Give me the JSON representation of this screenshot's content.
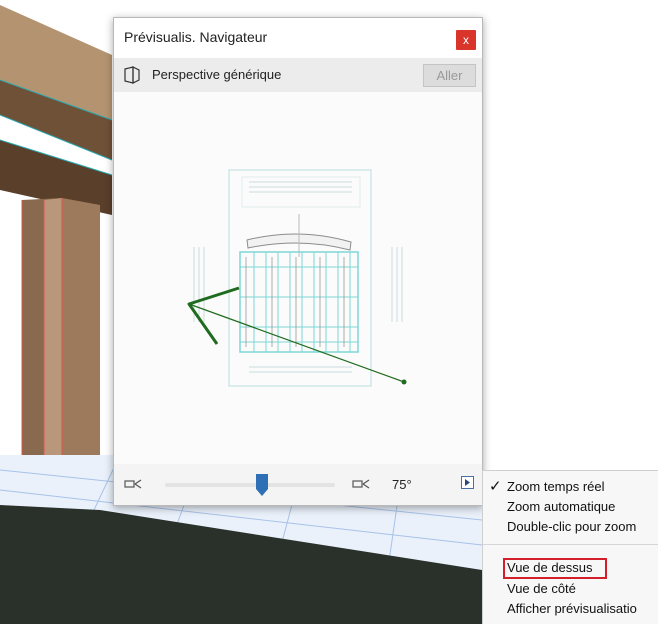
{
  "palette": {
    "title": "Prévisualis. Navigateur",
    "close_label": "x",
    "view_name": "Perspective générique",
    "go_label": "Aller",
    "camera_angle": "75°",
    "slider_value_fraction": 0.57
  },
  "context_menu": {
    "items": [
      {
        "label": "Zoom temps réel",
        "checked": true
      },
      {
        "label": "Zoom automatique",
        "checked": false
      },
      {
        "label": "Double-clic pour zoom",
        "checked": false
      }
    ],
    "items_after_separator": [
      {
        "label": "Vue de dessus",
        "highlighted": true
      },
      {
        "label": "Vue de côté",
        "highlighted": false
      },
      {
        "label": "Afficher prévisualisatio",
        "highlighted": false
      }
    ]
  },
  "colors": {
    "close_red": "#d9352b",
    "highlight_red": "#d21f2b",
    "slider_blue": "#2f6fb5",
    "camera_green": "#1f6b1f",
    "plan_cyan": "#7fd6d6"
  },
  "icons": {
    "close": "close-icon",
    "view": "3d-view-icon",
    "camera_left": "camera-icon",
    "camera_right": "camera-icon",
    "menu": "menu-arrow-icon",
    "check": "checkmark-icon"
  }
}
